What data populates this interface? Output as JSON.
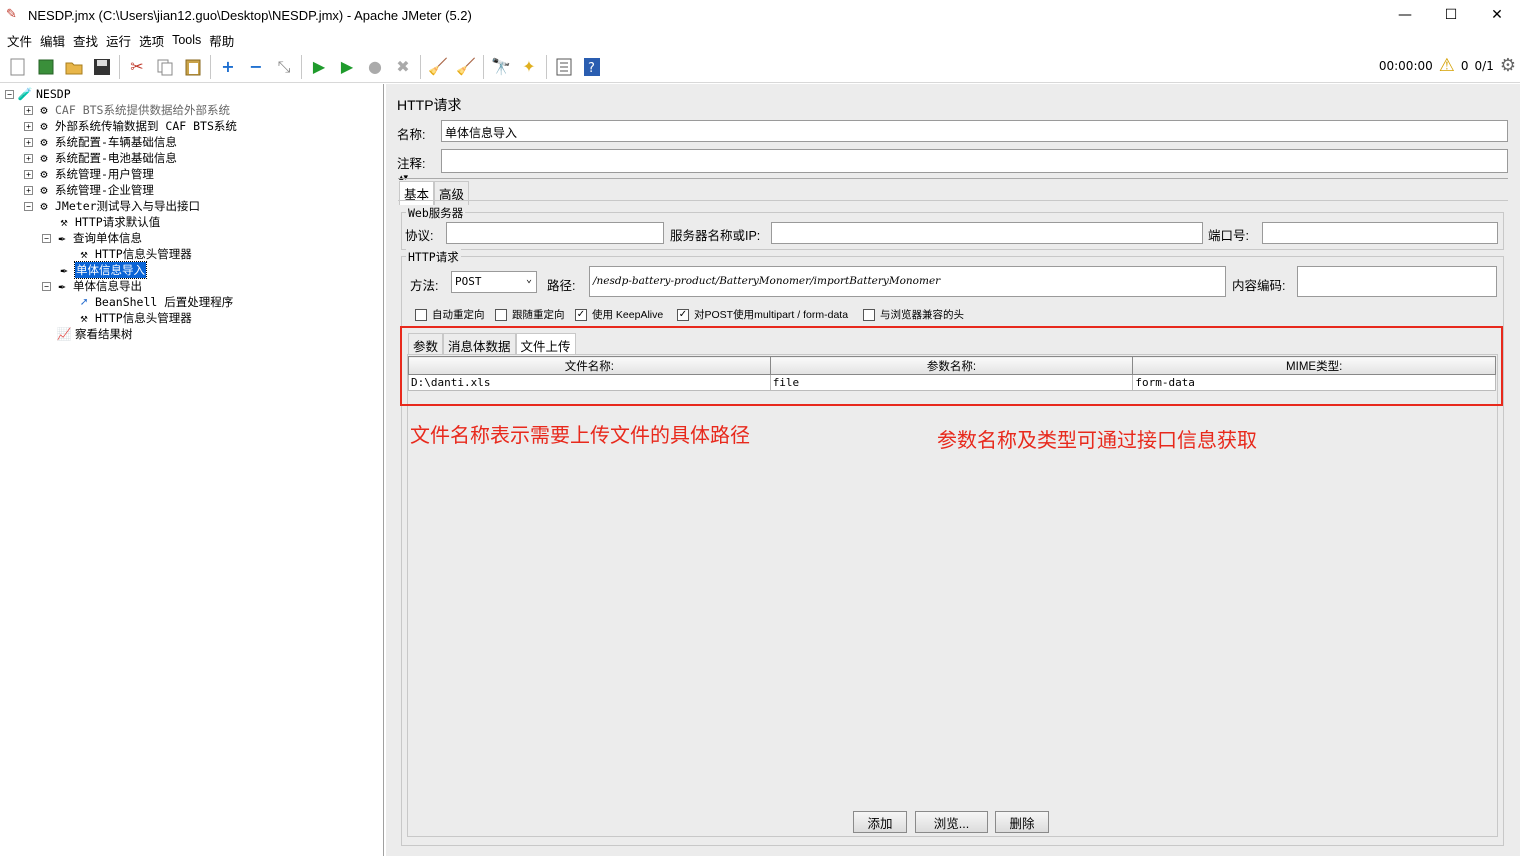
{
  "window": {
    "title": "NESDP.jmx (C:\\Users\\jian12.guo\\Desktop\\NESDP.jmx) - Apache JMeter (5.2)",
    "minimize": "—",
    "maximize": "☐",
    "close": "✕"
  },
  "menu": [
    "文件",
    "编辑",
    "查找",
    "运行",
    "选项",
    "Tools",
    "帮助"
  ],
  "toolbar": {
    "timer": "00:00:00",
    "warnings": "0",
    "threads": "0/1"
  },
  "tree": {
    "root": "NESDP",
    "items": [
      "CAF BTS系统提供数据给外部系统",
      "外部系统传输数据到 CAF BTS系统",
      "系统配置-车辆基础信息",
      "系统配置-电池基础信息",
      "系统管理-用户管理",
      "系统管理-企业管理",
      "JMeter测试导入与导出接口",
      "HTTP请求默认值",
      "查询单体信息",
      "HTTP信息头管理器",
      "单体信息导入",
      "单体信息导出",
      "BeanShell 后置处理程序",
      "HTTP信息头管理器",
      "察看结果树"
    ]
  },
  "panel": {
    "title": "HTTP请求",
    "name_label": "名称:",
    "name_value": "单体信息导入",
    "comment_label": "注释:",
    "comment_value": "",
    "tabs": [
      "基本",
      "高级"
    ],
    "web_server": {
      "legend": "Web服务器",
      "protocol_label": "协议:",
      "server_label": "服务器名称或IP:",
      "port_label": "端口号:"
    },
    "http_request": {
      "legend": "HTTP请求",
      "method_label": "方法:",
      "method_value": "POST",
      "path_label": "路径:",
      "path_value": "/nesdp-battery-product/BatteryMonomer/importBatteryMonomer",
      "encoding_label": "内容编码:"
    },
    "checkboxes": [
      {
        "label": "自动重定向",
        "checked": false
      },
      {
        "label": "跟随重定向",
        "checked": false
      },
      {
        "label": "使用 KeepAlive",
        "checked": true
      },
      {
        "label": "对POST使用multipart / form-data",
        "checked": true
      },
      {
        "label": "与浏览器兼容的头",
        "checked": false
      }
    ],
    "subtabs": [
      "参数",
      "消息体数据",
      "文件上传"
    ],
    "file_table": {
      "headers": [
        "文件名称:",
        "参数名称:",
        "MIME类型:"
      ],
      "rows": [
        [
          "D:\\danti.xls",
          "file",
          "form-data"
        ]
      ]
    },
    "buttons": {
      "add": "添加",
      "browse": "浏览...",
      "delete": "删除"
    }
  },
  "annotations": {
    "left": "文件名称表示需要上传文件的具体路径",
    "right": "参数名称及类型可通过接口信息获取",
    "color": "#e8291c"
  }
}
